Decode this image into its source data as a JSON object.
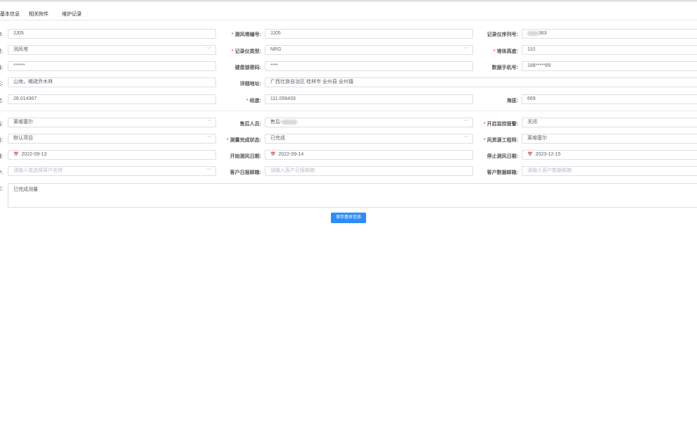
{
  "tabs": [
    "基本信息",
    "相关附件",
    "维护记录"
  ],
  "form": {
    "r1": {
      "c1_label": "称:",
      "c1_value": "JJ05",
      "c2_label": "测风塔编号:",
      "c2_value": "JJ05",
      "c3_label": "记录仪序列号:",
      "c3_value": "363"
    },
    "r2": {
      "c1_label": "型:",
      "c1_value": "测风塔",
      "c2_label": "记录仪类型:",
      "c2_value": "NRG",
      "c3_label": "塔体高度:",
      "c3_value": "110"
    },
    "r3": {
      "c1_label": "码:",
      "c1_value": "******",
      "c2_label": "键盘锁密码:",
      "c2_value": "****",
      "c3_label": "数据手机号:",
      "c3_value": "188*****89"
    },
    "r4": {
      "c1_label": "征:",
      "c1_value": "山地，稀疏乔木林",
      "c2_label": "详细地址:",
      "c2_value": "广西壮族自治区 桂林市 全州县 全州镇"
    },
    "r5": {
      "c1_label": "度:",
      "c1_value": "26.014367",
      "c2_label": "经度:",
      "c2_value": "111.056433",
      "c3_label": "海拔:",
      "c3_value": "669"
    },
    "r6": {
      "c1_label": "员:",
      "c1_value": "莱维塞尔",
      "c2_label": "售后人员:",
      "c2_value": "售后-",
      "c3_label": "开启监控报警:",
      "c3_value": "关闭"
    },
    "r7": {
      "c1_label": "目:",
      "c1_value": "默认项目",
      "c2_label": "测量完成状态:",
      "c2_value": "已完成",
      "c3_label": "风资源工程师:",
      "c3_value": "莱维塞尔"
    },
    "r8": {
      "c1_label": "期:",
      "c1_value": "2022-09-13",
      "c2_label": "开始测风日期:",
      "c2_value": "2022-09-14",
      "c3_label": "停止测风日期:",
      "c3_value": "2023-12-15"
    },
    "r9": {
      "c1_label": "户:",
      "c1_placeholder": "请输入或选择客户名称",
      "c2_label": "客户日报邮箱:",
      "c2_placeholder": "请输入客户日报邮箱",
      "c3_label": "客户数据邮箱:",
      "c3_placeholder": "请输入客户数据邮箱"
    },
    "r10": {
      "c1_label": "注:",
      "c1_value": "已完成测量"
    }
  },
  "save_label": "保存基本信息",
  "icons": {
    "chevron": "chevron-down-icon",
    "calendar": "calendar-icon"
  }
}
